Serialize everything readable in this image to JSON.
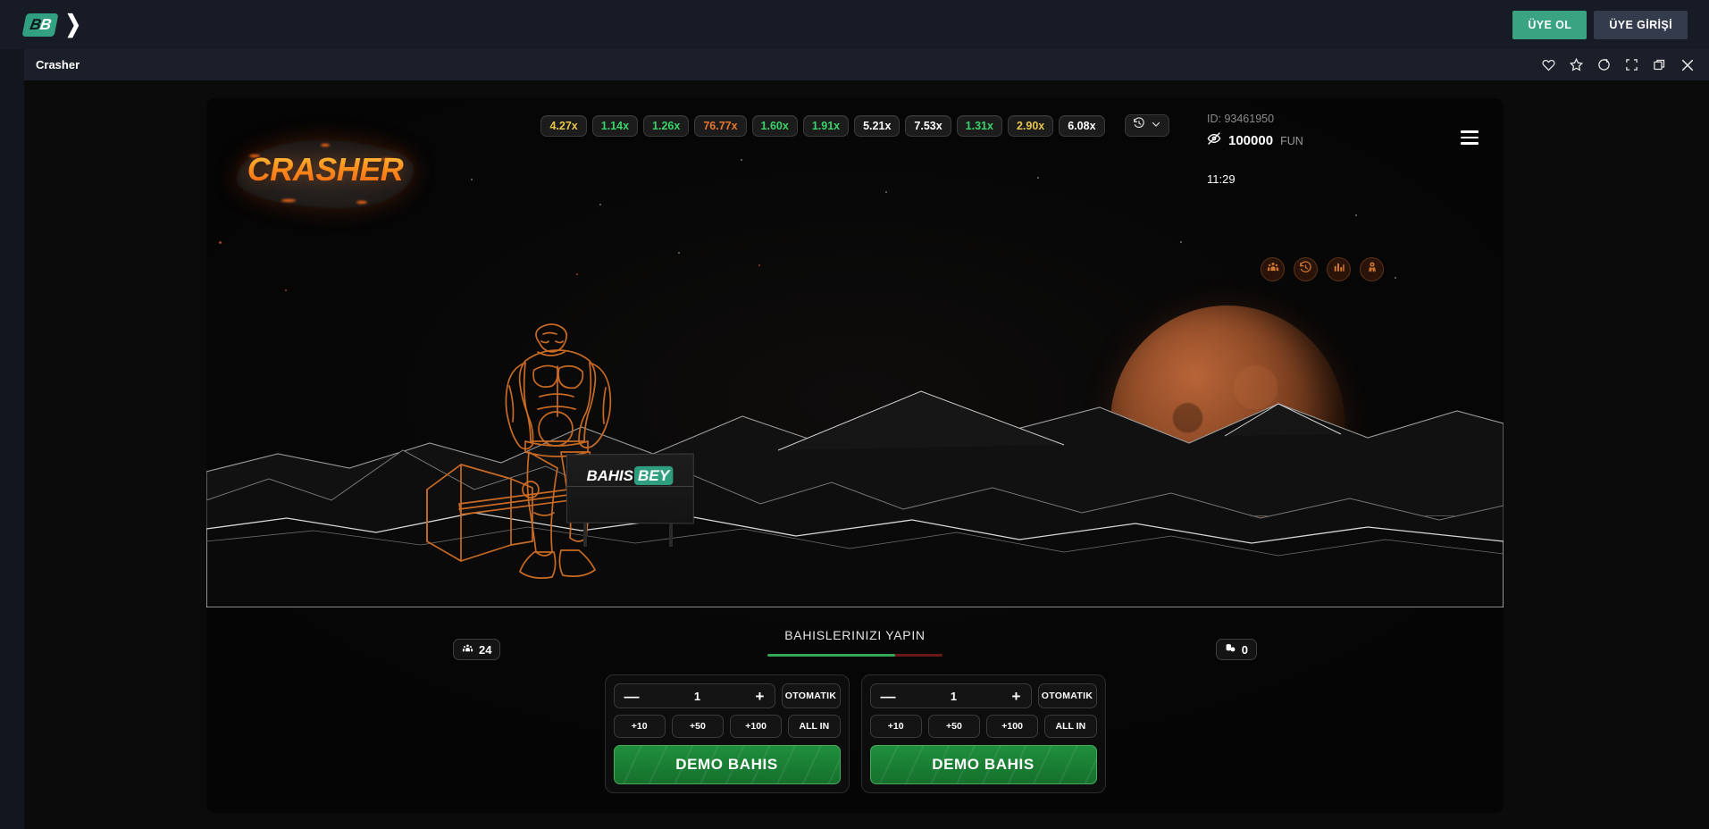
{
  "topbar": {
    "logo_left": "B",
    "logo_right": "B",
    "chevron": "❯",
    "signup_label": "ÜYE OL",
    "login_label": "ÜYE GİRİŞİ"
  },
  "gamebar": {
    "title": "Crasher",
    "icons": [
      "heart-icon",
      "star-icon",
      "refresh-icon",
      "fullscreen-icon",
      "popout-icon",
      "close-icon"
    ]
  },
  "game": {
    "logo_text": "CRASHER",
    "sign_text_a": "BAHIS",
    "sign_text_b": "BEY",
    "hamburger": "menu-icon"
  },
  "history": {
    "chips": [
      {
        "value": "4.27x",
        "tone": "yellow"
      },
      {
        "value": "1.14x",
        "tone": "green"
      },
      {
        "value": "1.26x",
        "tone": "green"
      },
      {
        "value": "76.77x",
        "tone": "orange"
      },
      {
        "value": "1.60x",
        "tone": "green"
      },
      {
        "value": "1.91x",
        "tone": "green"
      },
      {
        "value": "5.21x",
        "tone": "white"
      },
      {
        "value": "7.53x",
        "tone": "white"
      },
      {
        "value": "1.31x",
        "tone": "green"
      },
      {
        "value": "2.90x",
        "tone": "yellow"
      },
      {
        "value": "6.08x",
        "tone": "white"
      }
    ],
    "toggle_icon": "history-clock-icon",
    "toggle_chevron": "chevron-down-icon"
  },
  "hud": {
    "id_label": "ID: 93461950",
    "balance_icon": "eye-off-icon",
    "balance_amount": "100000",
    "currency": "FUN",
    "time": "11:29",
    "actions": [
      "players-icon",
      "history-icon",
      "stats-icon",
      "rank-icon"
    ]
  },
  "status": {
    "title": "BAHISLERINIZI YAPIN",
    "progress_percent": 73,
    "players_icon": "players-group-icon",
    "players_count": "24",
    "cashout_icon": "coins-icon",
    "cashout_count": "0"
  },
  "bet_panels": [
    {
      "decrement": "—",
      "amount": "1",
      "increment": "+",
      "auto_label": "OTOMATIK",
      "quick": [
        "+10",
        "+50",
        "+100",
        "ALL IN"
      ],
      "bet_label": "DEMO BAHIS"
    },
    {
      "decrement": "—",
      "amount": "1",
      "increment": "+",
      "auto_label": "OTOMATIK",
      "quick": [
        "+10",
        "+50",
        "+100",
        "ALL IN"
      ],
      "bet_label": "DEMO BAHIS"
    }
  ],
  "colors": {
    "accent_green": "#3aa382",
    "bet_green": "#1f8f3c",
    "chip_green": "#3ad46a",
    "chip_yellow": "#e8c64a",
    "chip_orange": "#e8762b",
    "planet_orange": "#8d4a26",
    "hero_orange": "#c86a24"
  }
}
